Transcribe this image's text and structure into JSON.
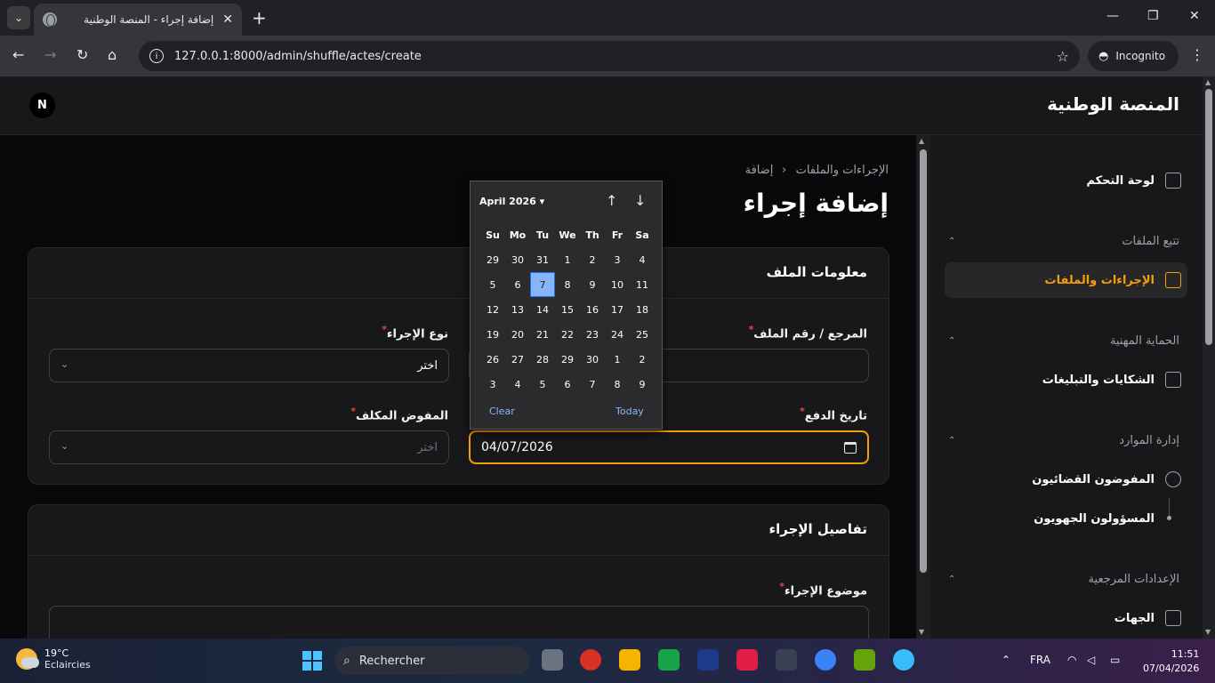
{
  "browser": {
    "tab_title": "إضافة إجراء - المنصة الوطنية",
    "url": "127.0.0.1:8000/admin/shuffle/actes/create",
    "profile_label": "Incognito"
  },
  "app": {
    "brand": "المنصة الوطنية",
    "avatar_initial": "N"
  },
  "breadcrumb": {
    "parent": "الإجراءات والملفات",
    "separator": "›",
    "current": "إضافة"
  },
  "page_title": "إضافة إجراء",
  "card_file": {
    "heading": "معلومات الملف",
    "ref_label": "المرجع / رقم الملف",
    "type_label": "نوع الإجراء",
    "type_value": "اختر",
    "date_label": "تاريخ الدفع",
    "date_value": "04/07/2026",
    "agent_label": "المفوض المكلف",
    "agent_placeholder": "اختر",
    "required_mark": "*"
  },
  "card_details": {
    "heading": "تفاصيل الإجراء",
    "subject_label": "موضوع الإجراء"
  },
  "datepicker": {
    "month": "April 2026",
    "weekdays": [
      "Su",
      "Mo",
      "Tu",
      "We",
      "Th",
      "Fr",
      "Sa"
    ],
    "days": [
      "29",
      "30",
      "31",
      "1",
      "2",
      "3",
      "4",
      "5",
      "6",
      "7",
      "8",
      "9",
      "10",
      "11",
      "12",
      "13",
      "14",
      "15",
      "16",
      "17",
      "18",
      "19",
      "20",
      "21",
      "22",
      "23",
      "24",
      "25",
      "26",
      "27",
      "28",
      "29",
      "30",
      "1",
      "2",
      "3",
      "4",
      "5",
      "6",
      "7",
      "8",
      "9"
    ],
    "selected_index": 9,
    "clear_label": "Clear",
    "today_label": "Today"
  },
  "sidebar": {
    "dashboard": "لوحة التحكم",
    "group_tracking": "تتبع الملفات",
    "item_procedures": "الإجراءات والملفات",
    "group_protection": "الحماية المهنية",
    "item_complaints": "الشكايات والتبليغات",
    "group_resources": "إدارة الموارد",
    "item_agents": "المفوضون القضائيون",
    "item_regional": "المسؤولون الجهويون",
    "group_settings": "الإعدادات المرجعية",
    "item_entities": "الجهات"
  },
  "taskbar": {
    "temperature": "19°C",
    "weather": "Eclaircies",
    "search": "Rechercher",
    "language": "FRA",
    "time": "11:51",
    "date": "07/04/2026"
  },
  "colors": {
    "accent": "#f59e0b",
    "required": "#ef4444",
    "selected_day": "#8ab4f8"
  }
}
